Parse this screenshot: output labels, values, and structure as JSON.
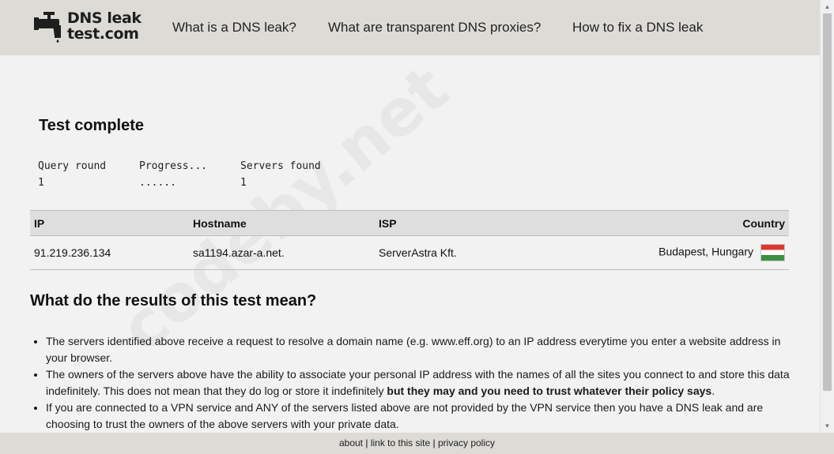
{
  "header": {
    "logo_line1": "DNS leak",
    "logo_line2": "test.com",
    "nav": [
      {
        "label": "What is a DNS leak?"
      },
      {
        "label": "What are transparent DNS proxies?"
      },
      {
        "label": "How to fix a DNS leak"
      }
    ]
  },
  "status": {
    "title": "Test complete",
    "query_round_label": "Query round",
    "progress_label": "Progress...",
    "servers_found_label": "Servers found",
    "query_round_value": "1",
    "progress_value": "......",
    "servers_found_value": "1"
  },
  "results": {
    "columns": [
      "IP",
      "Hostname",
      "ISP",
      "Country"
    ],
    "rows": [
      {
        "ip": "91.219.236.134",
        "hostname": "sa1194.azar-a.net.",
        "isp": "ServerAstra Kft.",
        "country": "Budapest, Hungary",
        "flag_icon": "hungary-flag-icon"
      }
    ]
  },
  "explanation": {
    "title": "What do the results of this test mean?",
    "bullet1": "The servers identified above receive a request to resolve a domain name (e.g. www.eff.org) to an IP address everytime you enter a website address in your browser.",
    "bullet2_text": "The owners of the servers above have the ability to associate your personal IP address with the names of all the sites you connect to and store this data indefinitely. This does not mean that they do log or store it indefinitely ",
    "bullet2_bold": "but they may and you need to trust whatever their policy says",
    "bullet2_end": ".",
    "bullet3": "If you are connected to a VPN service and ANY of the servers listed above are not provided by the VPN service then you have a DNS leak and are choosing to trust the owners of the above servers with your private data."
  },
  "footer": {
    "about": "about",
    "sep1": " | ",
    "link": "link to this site",
    "sep2": " | ",
    "privacy": "privacy policy"
  },
  "watermark": "codeby.net",
  "colors": {
    "header_bg": "#dcdbd6",
    "page_bg": "#f2f2f2",
    "table_header_bg": "#dedede"
  }
}
